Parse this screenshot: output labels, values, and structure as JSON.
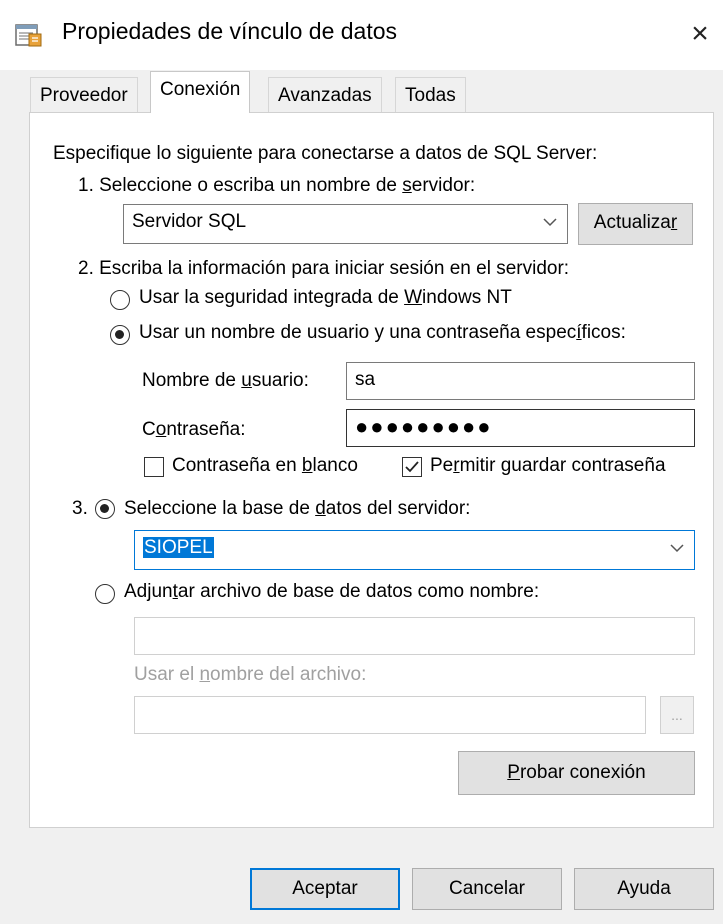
{
  "window": {
    "title": "Propiedades de vínculo de datos",
    "close_label": "×"
  },
  "tabs": [
    {
      "label": "Proveedor",
      "selected": false
    },
    {
      "label": "Conexión",
      "selected": true
    },
    {
      "label": "Avanzadas",
      "selected": false
    },
    {
      "label": "Todas",
      "selected": false
    }
  ],
  "connection": {
    "intro": "Especifique lo siguiente para conectarse a datos de SQL Server:",
    "step1": {
      "label_pre": "1. Seleccione o escriba un nombre de ",
      "label_u": "s",
      "label_post": "ervidor:",
      "server_value": "Servidor SQL",
      "refresh_pre": "Actualiza",
      "refresh_u": "r",
      "refresh_post": ""
    },
    "step2": {
      "label": "2. Escriba la información para iniciar sesión en el servidor:",
      "integrated_pre": "Usar la seguridad integrada de ",
      "integrated_u": "W",
      "integrated_post": "indows NT",
      "specific_pre": "Usar un nombre de usuario y una contraseña espec",
      "specific_u": "í",
      "specific_post": "ficos:",
      "username_label_pre": "Nombre de ",
      "username_label_u": "u",
      "username_label_post": "suario:",
      "username_value": "sa",
      "password_label_pre": "C",
      "password_label_u": "o",
      "password_label_post": "ntraseña:",
      "password_value": "●●●●●●●●●",
      "blank_pre": "Contraseña en ",
      "blank_u": "b",
      "blank_post": "lanco",
      "blank_checked": false,
      "save_pre": "Pe",
      "save_u": "r",
      "save_post": "mitir guardar contraseña",
      "save_checked": true
    },
    "step3": {
      "number": "3.",
      "select_db_pre": "Seleccione la base de ",
      "select_db_u": "d",
      "select_db_post": "atos del servidor:",
      "database_value": "SIOPEL",
      "attach_pre": "Adjun",
      "attach_u": "t",
      "attach_post": "ar archivo de base de datos como nombre:",
      "attach_value": "",
      "filename_pre": "Usar el ",
      "filename_u": "n",
      "filename_post": "ombre del archivo:",
      "filename_value": "",
      "browse_label": "...",
      "test_pre": "",
      "test_u": "P",
      "test_post": "robar conexión"
    }
  },
  "footer": {
    "ok": "Aceptar",
    "cancel": "Cancelar",
    "help": "Ayuda"
  },
  "colors": {
    "accent": "#0078d7",
    "client_background": "#f0f0f0",
    "button_face": "#e1e1e1"
  }
}
